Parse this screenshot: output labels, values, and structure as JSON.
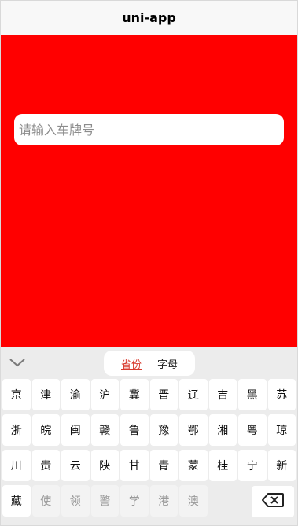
{
  "navbar": {
    "title": "uni-app"
  },
  "main": {
    "plate_input": {
      "placeholder": "请输入车牌号",
      "value": ""
    }
  },
  "keyboard": {
    "collapse_icon": "chevron-down-icon",
    "tabs": {
      "province": "省份",
      "letter": "字母",
      "active": "province"
    },
    "rows": [
      [
        "京",
        "津",
        "渝",
        "沪",
        "冀",
        "晋",
        "辽",
        "吉",
        "黑",
        "苏"
      ],
      [
        "浙",
        "皖",
        "闽",
        "赣",
        "鲁",
        "豫",
        "鄂",
        "湘",
        "粤",
        "琼"
      ],
      [
        "川",
        "贵",
        "云",
        "陕",
        "甘",
        "青",
        "蒙",
        "桂",
        "宁",
        "新"
      ]
    ],
    "last_row": {
      "enabled": [
        "藏"
      ],
      "disabled": [
        "使",
        "领",
        "警",
        "学",
        "港",
        "澳"
      ]
    },
    "delete_icon": "backspace-icon"
  },
  "colors": {
    "background": "#ff0000",
    "active_tab": "#d83a2e"
  }
}
